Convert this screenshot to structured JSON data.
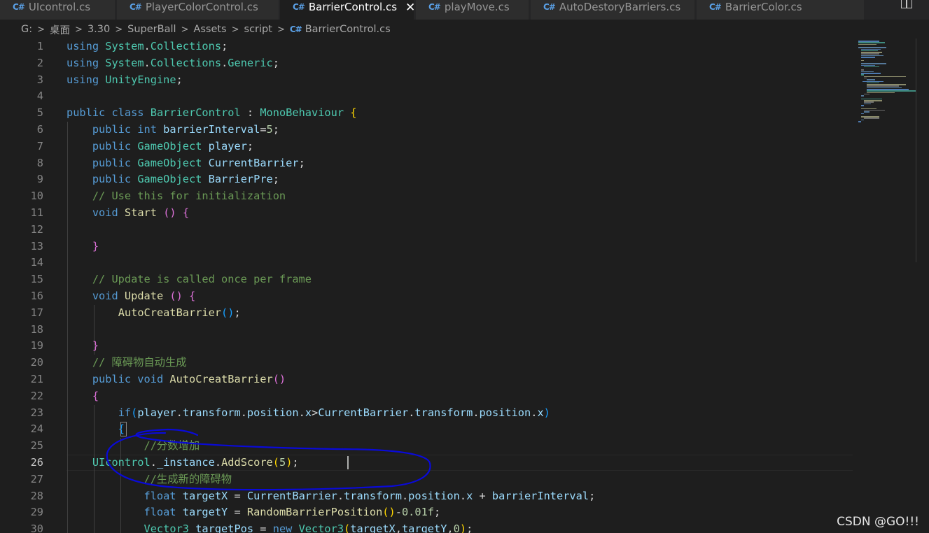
{
  "tabs": [
    {
      "label": "UIcontrol.cs",
      "icon": "csharp-file-icon",
      "active": false
    },
    {
      "label": "PlayerColorControl.cs",
      "icon": "csharp-file-icon",
      "active": false
    },
    {
      "label": "BarrierControl.cs",
      "icon": "csharp-file-icon",
      "active": true
    },
    {
      "label": "playMove.cs",
      "icon": "csharp-file-icon",
      "active": false
    },
    {
      "label": "AutoDestoryBarriers.cs",
      "icon": "csharp-file-icon",
      "active": false
    },
    {
      "label": "BarrierColor.cs",
      "icon": "csharp-file-icon",
      "active": false
    }
  ],
  "tab_icon_text": "C#",
  "tab_close_glyph": "✕",
  "editor_actions": {
    "split_icon": "split-editor-icon"
  },
  "breadcrumb": {
    "items": [
      "G:",
      "桌面",
      "3.30",
      "SuperBall",
      "Assets",
      "script"
    ],
    "file": "BarrierControl.cs",
    "separator": ">"
  },
  "editor": {
    "current_line": 26,
    "lines": [
      {
        "n": 1,
        "tokens": [
          [
            "kw",
            "using "
          ],
          [
            "ty",
            "System"
          ],
          [
            "",
            "."
          ],
          [
            "ty",
            "Collections"
          ],
          [
            "",
            ";"
          ]
        ]
      },
      {
        "n": 2,
        "tokens": [
          [
            "kw",
            "using "
          ],
          [
            "ty",
            "System"
          ],
          [
            "",
            "."
          ],
          [
            "ty",
            "Collections"
          ],
          [
            "",
            "."
          ],
          [
            "ty",
            "Generic"
          ],
          [
            "",
            ";"
          ]
        ]
      },
      {
        "n": 3,
        "tokens": [
          [
            "kw",
            "using "
          ],
          [
            "ty",
            "UnityEngine"
          ],
          [
            "",
            ";"
          ]
        ]
      },
      {
        "n": 4,
        "tokens": []
      },
      {
        "n": 5,
        "tokens": [
          [
            "kw",
            "public class "
          ],
          [
            "ty",
            "BarrierControl"
          ],
          [
            "",
            " : "
          ],
          [
            "ty",
            "MonoBehaviour"
          ],
          [
            "",
            " "
          ],
          [
            "b1",
            "{"
          ]
        ]
      },
      {
        "n": 6,
        "tokens": [
          [
            "",
            "    "
          ],
          [
            "kw",
            "public int "
          ],
          [
            "vr",
            "barrierInterval"
          ],
          [
            "",
            "="
          ],
          [
            "nm",
            "5"
          ],
          [
            "",
            ";"
          ]
        ]
      },
      {
        "n": 7,
        "tokens": [
          [
            "",
            "    "
          ],
          [
            "kw",
            "public "
          ],
          [
            "ty",
            "GameObject"
          ],
          [
            "",
            " "
          ],
          [
            "vr",
            "player"
          ],
          [
            "",
            ";"
          ]
        ]
      },
      {
        "n": 8,
        "tokens": [
          [
            "",
            "    "
          ],
          [
            "kw",
            "public "
          ],
          [
            "ty",
            "GameObject"
          ],
          [
            "",
            " "
          ],
          [
            "vr",
            "CurrentBarrier"
          ],
          [
            "",
            ";"
          ]
        ]
      },
      {
        "n": 9,
        "tokens": [
          [
            "",
            "    "
          ],
          [
            "kw",
            "public "
          ],
          [
            "ty",
            "GameObject"
          ],
          [
            "",
            " "
          ],
          [
            "vr",
            "BarrierPre"
          ],
          [
            "",
            ";"
          ]
        ]
      },
      {
        "n": 10,
        "tokens": [
          [
            "",
            "    "
          ],
          [
            "cm",
            "// Use this for initialization"
          ]
        ]
      },
      {
        "n": 11,
        "tokens": [
          [
            "",
            "    "
          ],
          [
            "kw",
            "void "
          ],
          [
            "fn",
            "Start"
          ],
          [
            "",
            " "
          ],
          [
            "b2",
            "()"
          ],
          [
            "",
            " "
          ],
          [
            "b2",
            "{"
          ]
        ]
      },
      {
        "n": 12,
        "tokens": []
      },
      {
        "n": 13,
        "tokens": [
          [
            "",
            "    "
          ],
          [
            "b2",
            "}"
          ]
        ]
      },
      {
        "n": 14,
        "tokens": []
      },
      {
        "n": 15,
        "tokens": [
          [
            "",
            "    "
          ],
          [
            "cm",
            "// Update is called once per frame"
          ]
        ]
      },
      {
        "n": 16,
        "tokens": [
          [
            "",
            "    "
          ],
          [
            "kw",
            "void "
          ],
          [
            "fn",
            "Update"
          ],
          [
            "",
            " "
          ],
          [
            "b2",
            "()"
          ],
          [
            "",
            " "
          ],
          [
            "b2",
            "{"
          ]
        ]
      },
      {
        "n": 17,
        "tokens": [
          [
            "",
            "        "
          ],
          [
            "fn",
            "AutoCreatBarrier"
          ],
          [
            "b3",
            "()"
          ],
          [
            "",
            ";"
          ]
        ]
      },
      {
        "n": 18,
        "tokens": []
      },
      {
        "n": 19,
        "tokens": [
          [
            "",
            "    "
          ],
          [
            "b2",
            "}"
          ]
        ]
      },
      {
        "n": 20,
        "tokens": [
          [
            "",
            "    "
          ],
          [
            "cm",
            "// 障碍物自动生成"
          ]
        ]
      },
      {
        "n": 21,
        "tokens": [
          [
            "",
            "    "
          ],
          [
            "kw",
            "public void "
          ],
          [
            "fn",
            "AutoCreatBarrier"
          ],
          [
            "b2",
            "()"
          ]
        ]
      },
      {
        "n": 22,
        "tokens": [
          [
            "",
            "    "
          ],
          [
            "b2",
            "{"
          ]
        ]
      },
      {
        "n": 23,
        "tokens": [
          [
            "",
            "        "
          ],
          [
            "kw",
            "if"
          ],
          [
            "b3",
            "("
          ],
          [
            "vr",
            "player"
          ],
          [
            "",
            "."
          ],
          [
            "vr",
            "transform"
          ],
          [
            "",
            "."
          ],
          [
            "vr",
            "position"
          ],
          [
            "",
            "."
          ],
          [
            "vr",
            "x"
          ],
          [
            "",
            ">"
          ],
          [
            "vr",
            "CurrentBarrier"
          ],
          [
            "",
            "."
          ],
          [
            "vr",
            "transform"
          ],
          [
            "",
            "."
          ],
          [
            "vr",
            "position"
          ],
          [
            "",
            "."
          ],
          [
            "vr",
            "x"
          ],
          [
            "b3",
            ")"
          ]
        ]
      },
      {
        "n": 24,
        "tokens": [
          [
            "",
            "        "
          ],
          [
            "b3",
            "{"
          ]
        ]
      },
      {
        "n": 25,
        "tokens": [
          [
            "",
            "            "
          ],
          [
            "cm",
            "//分数增加"
          ]
        ]
      },
      {
        "n": 26,
        "tokens": [
          [
            "",
            "    "
          ],
          [
            "ty",
            "UIcontrol"
          ],
          [
            "",
            "."
          ],
          [
            "vr",
            "_instance"
          ],
          [
            "",
            "."
          ],
          [
            "fn",
            "AddScore"
          ],
          [
            "b1",
            "("
          ],
          [
            "nm",
            "5"
          ],
          [
            "b1",
            ")"
          ],
          [
            "",
            ";"
          ]
        ]
      },
      {
        "n": 27,
        "tokens": [
          [
            "",
            "            "
          ],
          [
            "cm",
            "//生成新的障碍物"
          ]
        ]
      },
      {
        "n": 28,
        "tokens": [
          [
            "",
            "            "
          ],
          [
            "kw",
            "float "
          ],
          [
            "vr",
            "targetX"
          ],
          [
            "",
            " = "
          ],
          [
            "vr",
            "CurrentBarrier"
          ],
          [
            "",
            "."
          ],
          [
            "vr",
            "transform"
          ],
          [
            "",
            "."
          ],
          [
            "vr",
            "position"
          ],
          [
            "",
            "."
          ],
          [
            "vr",
            "x"
          ],
          [
            "",
            " + "
          ],
          [
            "vr",
            "barrierInterval"
          ],
          [
            "",
            ";"
          ]
        ]
      },
      {
        "n": 29,
        "tokens": [
          [
            "",
            "            "
          ],
          [
            "kw",
            "float "
          ],
          [
            "vr",
            "targetY"
          ],
          [
            "",
            " = "
          ],
          [
            "fn",
            "RandomBarrierPosition"
          ],
          [
            "b1",
            "()"
          ],
          [
            "",
            "-"
          ],
          [
            "nm",
            "0.01f"
          ],
          [
            "",
            ";"
          ]
        ]
      },
      {
        "n": 30,
        "tokens": [
          [
            "",
            "            "
          ],
          [
            "ty",
            "Vector3"
          ],
          [
            "",
            " "
          ],
          [
            "vr",
            "targetPos"
          ],
          [
            "",
            " = "
          ],
          [
            "kw",
            "new "
          ],
          [
            "ty",
            "Vector3"
          ],
          [
            "b1",
            "("
          ],
          [
            "vr",
            "targetX"
          ],
          [
            "",
            ","
          ],
          [
            "vr",
            "targetY"
          ],
          [
            "",
            ","
          ],
          [
            "nm",
            "0"
          ],
          [
            "b1",
            ")"
          ],
          [
            "",
            ";"
          ]
        ]
      }
    ]
  },
  "minimap": {
    "show": true
  },
  "annotation": {
    "shape": "hand-drawn-ellipse",
    "color": "#0a0ad8"
  },
  "watermark": "CSDN @GO!!!"
}
